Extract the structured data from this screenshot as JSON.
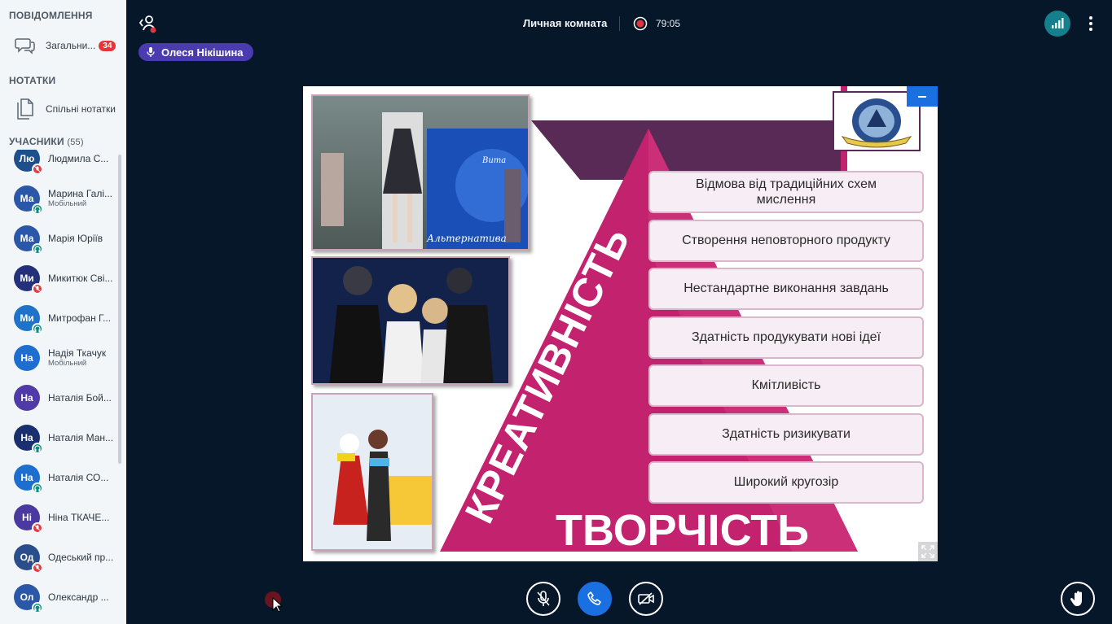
{
  "sidebar": {
    "messages_title": "ПОВІДОМЛЕННЯ",
    "general_chat_label": "Загальни...",
    "general_chat_unread": "34",
    "notes_title": "НОТАТКИ",
    "shared_notes_label": "Спільні нотатки",
    "participants_title": "УЧАСНИКИ",
    "participants_count": "(55)",
    "users": [
      {
        "initials": "Лю",
        "name": "Людмила С...",
        "status": "",
        "color": "#1c4f8c",
        "state": "muted"
      },
      {
        "initials": "Ма",
        "name": "Марина Галі...",
        "status": "Мобільний",
        "color": "#2a57a8",
        "state": "listen"
      },
      {
        "initials": "Ма",
        "name": "Марія Юріїв",
        "status": "",
        "color": "#2a57a8",
        "state": "listen"
      },
      {
        "initials": "Ми",
        "name": "Микитюк Сві...",
        "status": "",
        "color": "#24307a",
        "state": "muted"
      },
      {
        "initials": "Ми",
        "name": "Митрофан Г...",
        "status": "",
        "color": "#1e72c7",
        "state": "listen"
      },
      {
        "initials": "На",
        "name": "Надія Ткачук",
        "status": "Мобільний",
        "color": "#1e6ed0",
        "state": "none"
      },
      {
        "initials": "На",
        "name": "Наталія Бой...",
        "status": "",
        "color": "#4f3aa8",
        "state": "none"
      },
      {
        "initials": "На",
        "name": "Наталія Ман...",
        "status": "",
        "color": "#1a2f6f",
        "state": "listen"
      },
      {
        "initials": "На",
        "name": "Наталія СО...",
        "status": "",
        "color": "#1e6ed0",
        "state": "listen"
      },
      {
        "initials": "Ні",
        "name": "Ніна ТКАЧЕ...",
        "status": "",
        "color": "#4a3aa0",
        "state": "muted"
      },
      {
        "initials": "Од",
        "name": "Одеський пр...",
        "status": "",
        "color": "#2a4e8c",
        "state": "muted"
      },
      {
        "initials": "Ол",
        "name": "Олександр ...",
        "status": "",
        "color": "#2a57a8",
        "state": "listen"
      }
    ]
  },
  "topbar": {
    "room_name": "Личная комната",
    "recording_time": "79:05"
  },
  "talker": {
    "name": "Олеся Нікішина"
  },
  "slide": {
    "side_title": "КРЕАТИВНІСТЬ",
    "bottom_title": "ТВОРЧІСТЬ",
    "photo1_sign": "Альтернатива",
    "photo1_sign2": "Вита",
    "traits": [
      "Відмова від традиційних схем мислення",
      "Створення неповторного продукту",
      "Нестандартне виконання завдань",
      "Здатність продукувати нові ідеї",
      "Кмітливість",
      "Здатність ризикувати",
      "Широкий кругозір"
    ]
  },
  "colors": {
    "background": "#06172a",
    "accent_blue": "#1a6fe1",
    "slide_magenta": "#c2226e",
    "slide_purple": "#5a2a56"
  }
}
